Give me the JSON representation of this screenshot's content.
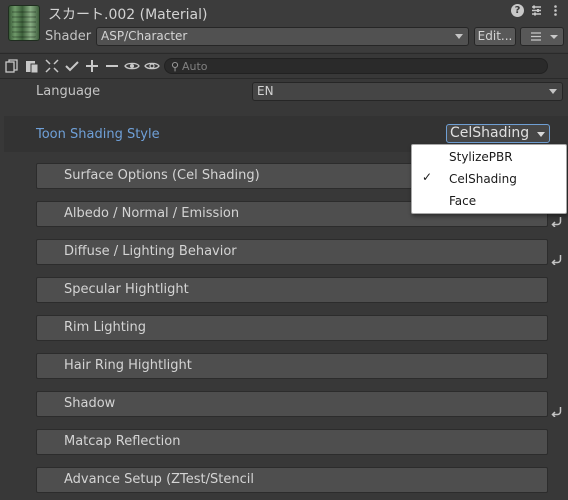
{
  "header": {
    "title": "スカート.002 (Material)",
    "icons": [
      "help-icon",
      "preset-icon",
      "more-icon"
    ],
    "shader_label": "Shader",
    "shader_value": "ASP/Character",
    "edit_label": "Edit...",
    "list_icon": "list-icon"
  },
  "toolbar": {
    "tools": [
      "copy-icon",
      "paste-icon",
      "expand-icon",
      "check-icon",
      "plus-icon",
      "minus-icon",
      "eye-icon",
      "eye-icon"
    ],
    "search_placeholder": "Auto"
  },
  "language": {
    "label": "Language",
    "value": "EN"
  },
  "toon": {
    "label": "Toon Shading Style",
    "value": "CelShading",
    "accent": "#6fa0d8"
  },
  "sections": [
    {
      "label": "Surface Options (Cel Shading)",
      "reset": false
    },
    {
      "label": "Albedo / Normal / Emission",
      "reset": true
    },
    {
      "label": "Diffuse / Lighting Behavior",
      "reset": true
    },
    {
      "label": "Specular Hightlight",
      "reset": false
    },
    {
      "label": "Rim Lighting",
      "reset": false
    },
    {
      "label": "Hair Ring Hightlight",
      "reset": false
    },
    {
      "label": "Shadow",
      "reset": true
    },
    {
      "label": "Matcap Reflection",
      "reset": false
    },
    {
      "label": "Advance Setup (ZTest/Stencil",
      "reset": false
    }
  ],
  "menu": {
    "items": [
      {
        "label": "StylizePBR",
        "checked": false
      },
      {
        "label": "CelShading",
        "checked": true
      },
      {
        "label": "Face",
        "checked": false
      }
    ],
    "check_glyph": "✓"
  }
}
